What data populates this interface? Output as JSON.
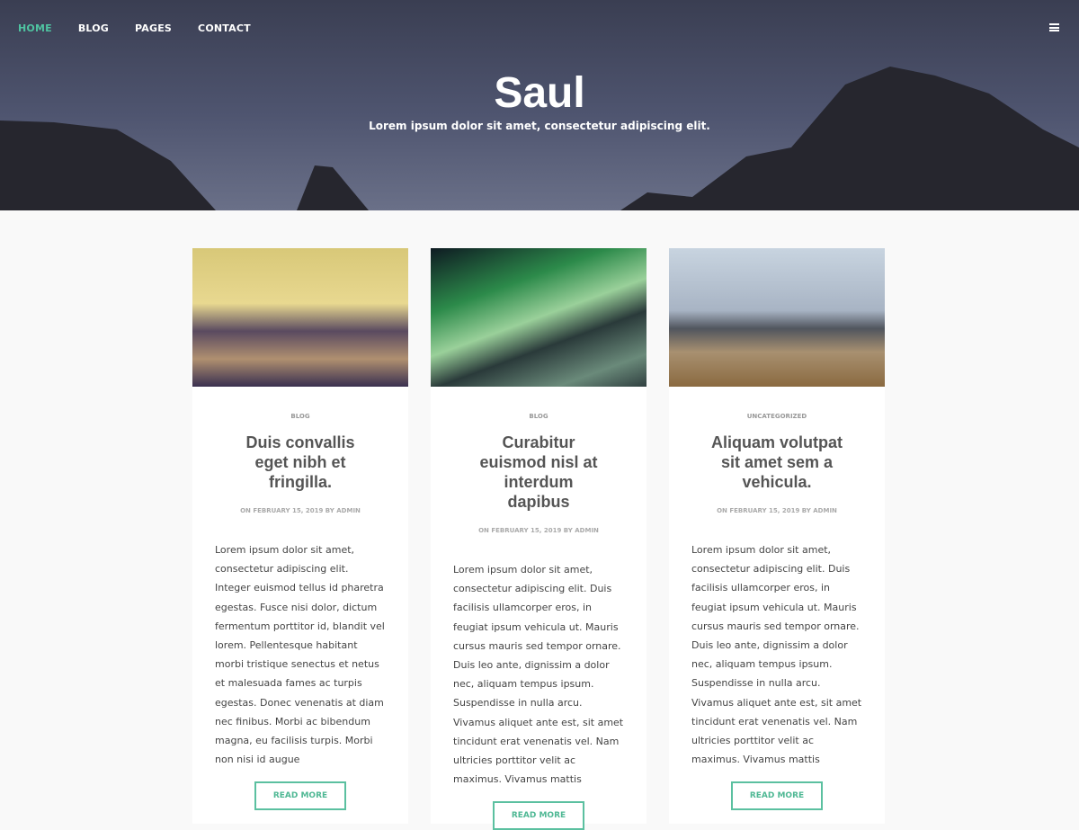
{
  "nav": {
    "items": [
      {
        "label": "HOME",
        "active": true
      },
      {
        "label": "BLOG"
      },
      {
        "label": "PAGES"
      },
      {
        "label": "CONTACT"
      }
    ],
    "menu_icon": "hamburger-icon"
  },
  "hero": {
    "title": "Saul",
    "subtitle": "Lorem ipsum dolor sit amet, consectetur adipiscing elit."
  },
  "accent": "#5bc0a0",
  "posts": [
    {
      "category": "BLOG",
      "title": "Duis convallis eget nibh et fringilla.",
      "meta": "ON FEBRUARY 15, 2019 BY ADMIN",
      "excerpt": "Lorem ipsum dolor sit amet, consectetur adipiscing elit. Integer euismod tellus id pharetra egestas. Fusce nisi dolor, dictum fermentum porttitor id, blandit vel lorem. Pellentesque habitant morbi tristique senectus et netus et malesuada fames ac turpis egestas. Donec venenatis at diam nec finibus. Morbi ac bibendum magna, eu facilisis turpis. Morbi non nisi id augue",
      "button": "READ MORE",
      "image": "lighthouse"
    },
    {
      "category": "BLOG",
      "title": "Curabitur euismod nisl at interdum dapibus",
      "meta": "ON FEBRUARY 15, 2019 BY ADMIN",
      "excerpt": "Lorem ipsum dolor sit amet, consectetur adipiscing elit. Duis facilisis ullamcorper eros, in feugiat ipsum vehicula ut. Mauris cursus mauris sed tempor ornare. Duis leo ante, dignissim a dolor nec, aliquam tempus ipsum. Suspendisse in nulla arcu. Vivamus aliquet ante est, sit amet tincidunt erat venenatis vel. Nam ultricies porttitor velit ac maximus. Vivamus mattis",
      "button": "READ MORE",
      "image": "aurora"
    },
    {
      "category": "UNCATEGORIZED",
      "title": "Aliquam volutpat sit amet sem a vehicula.",
      "meta": "ON FEBRUARY 15, 2019 BY ADMIN",
      "excerpt": "Lorem ipsum dolor sit amet, consectetur adipiscing elit. Duis facilisis ullamcorper eros, in feugiat ipsum vehicula ut. Mauris cursus mauris sed tempor ornare. Duis leo ante, dignissim a dolor nec, aliquam tempus ipsum. Suspendisse in nulla arcu. Vivamus aliquet ante est, sit amet tincidunt erat venenatis vel. Nam ultricies porttitor velit ac maximus. Vivamus mattis",
      "button": "READ MORE",
      "image": "airplane"
    }
  ]
}
